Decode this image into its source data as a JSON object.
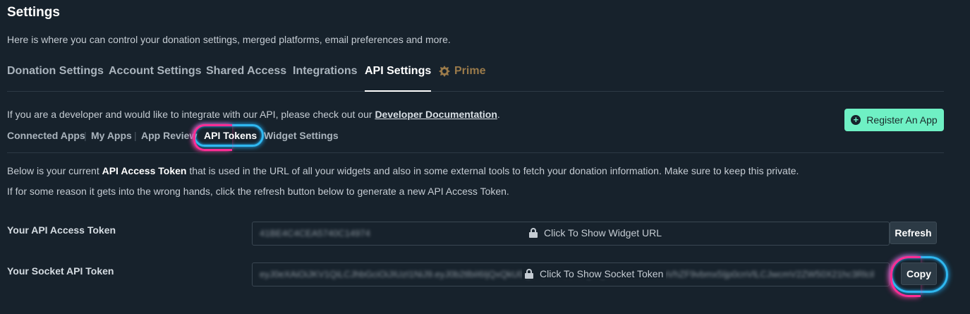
{
  "header": {
    "title": "Settings",
    "subtitle": "Here is where you can control your donation settings, merged platforms, email preferences and more."
  },
  "tabs": [
    {
      "label": "Donation Settings"
    },
    {
      "label": "Account Settings"
    },
    {
      "label": "Shared Access"
    },
    {
      "label": "Integrations"
    },
    {
      "label": "API Settings",
      "active": true
    },
    {
      "label": "Prime",
      "icon": "prime-gear-icon"
    }
  ],
  "intro": {
    "text": "If you are a developer and would like to integrate with our API, please check out our ",
    "link": "Developer Documentation",
    "after": "."
  },
  "subnav": [
    {
      "label": "Connected Apps"
    },
    {
      "label": "My Apps"
    },
    {
      "label": "App Review"
    },
    {
      "label": "API Tokens",
      "active": true
    },
    {
      "label": "Widget Settings"
    }
  ],
  "register_button": {
    "label": "Register An App",
    "icon": "plus-circle-icon"
  },
  "description": {
    "line1_pre": "Below is your current ",
    "line1_bold": "API Access Token",
    "line1_post": " that is used in the URL of all your widgets and also in some external tools to fetch your donation information. Make sure to keep this private.",
    "line2": "If for some reason it gets into the wrong hands, click the refresh button below to generate a new API Access Token."
  },
  "api_token": {
    "label": "Your API Access Token",
    "masked_value": "41BE4C4CEA5740C14974",
    "show_text": "Click To Show Widget URL",
    "button": "Refresh"
  },
  "socket_token": {
    "label": "Your Socket API Token",
    "masked_value": "eyJ0eXAiOiJKV1QiLCJhbGciOiJIUzI1NiJ9.eyJ0b2tlbiI6IjQxQkU0QzRDRUE1NzQwQzE0OTc0IiwicmVhZF9vbmx5Ijp0cnVlLCJwcmV2ZW50X21hc3Rlcil",
    "show_text": "Click To Show Socket Token",
    "button": "Copy"
  },
  "colors": {
    "background": "#17222c",
    "accent_green": "#6ff0c4",
    "prime_gold": "#9a7a4a",
    "glow_pink": "#ff2d95",
    "glow_blue": "#2fb8f0"
  }
}
